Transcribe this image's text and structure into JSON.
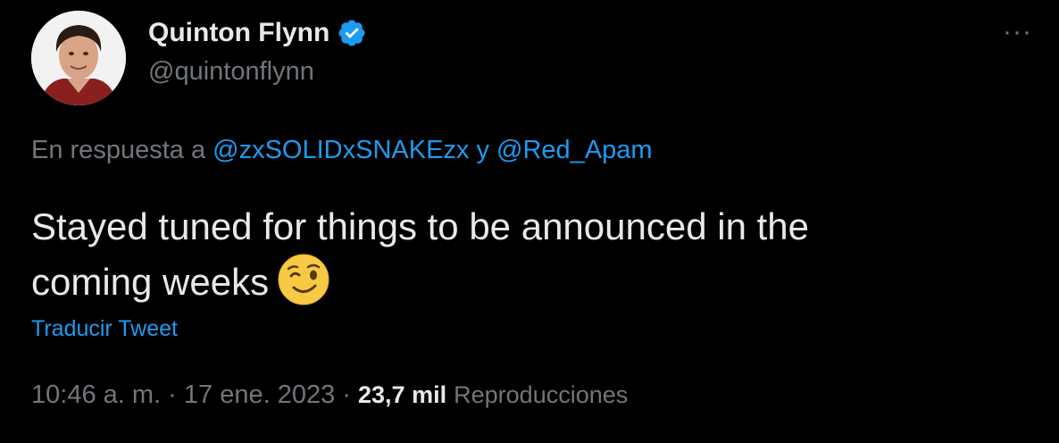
{
  "author": {
    "display_name": "Quinton Flynn",
    "handle": "@quintonflynn",
    "avatar_icon": "profile-photo",
    "verified_icon": "verified-badge-icon",
    "verified_color": "#1d9bf0"
  },
  "menu": {
    "more_label": "···"
  },
  "reply": {
    "prefix": "En respuesta a",
    "mention_1": "@zxSOLIDxSNAKEzx",
    "joiner": "y",
    "mention_2": "@Red_Apam"
  },
  "tweet": {
    "line_1": "Stayed tuned for things to be announced in the",
    "line_2": "coming weeks",
    "emoji": "winking-face-icon"
  },
  "translate_label": "Traducir Tweet",
  "meta": {
    "time": "10:46 a. m.",
    "sep_1": "·",
    "date": "17 ene. 2023",
    "sep_2": "·",
    "views_count": "23,7 mil",
    "views_label": "Reproducciones"
  },
  "colors": {
    "background": "#000000",
    "text": "#e7e9ea",
    "muted": "#71767b",
    "accent": "#1d9bf0"
  }
}
